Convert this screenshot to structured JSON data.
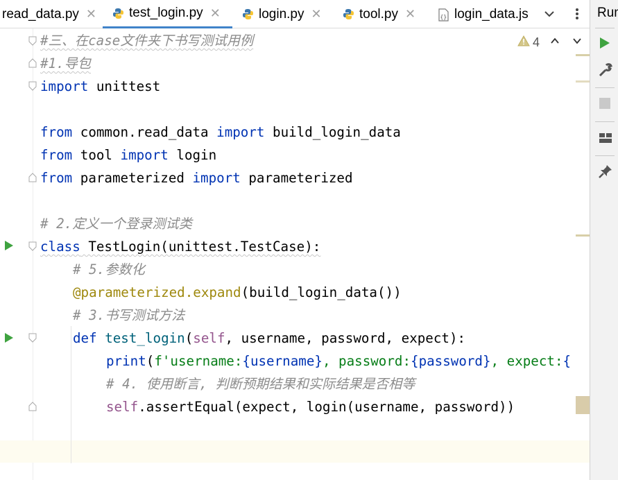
{
  "tabs": [
    {
      "label": "read_data.py",
      "active": false,
      "closable": true
    },
    {
      "label": "test_login.py",
      "active": true,
      "closable": true
    },
    {
      "label": "login.py",
      "active": false,
      "closable": true
    },
    {
      "label": "tool.py",
      "active": false,
      "closable": true
    },
    {
      "label": "login_data.js",
      "active": false,
      "closable": false
    }
  ],
  "right_panel": {
    "title": "Run"
  },
  "inspection": {
    "warning_count": "4"
  },
  "code": {
    "l1": "#三、在case文件夹下书写测试用例",
    "l2": "#1.导包",
    "l3_kw": "import",
    "l3_rest": " unittest",
    "l5_from": "from",
    "l5_mod": " common.read_data ",
    "l5_imp": "import",
    "l5_rest": " build_login_data",
    "l6_from": "from",
    "l6_mod": " tool ",
    "l6_imp": "import",
    "l6_rest": " login",
    "l7_from": "from",
    "l7_mod": " parameterized ",
    "l7_imp": "import",
    "l7_rest": " parameterized",
    "l9": "# 2.定义一个登录测试类",
    "l10_kw": "class",
    "l10_rest": " TestLogin(unittest.TestCase):",
    "l11": "# 5.参数化",
    "l12_deco": "@parameterized.expand",
    "l12_rest": "(build_login_data())",
    "l13": "# 3.书写测试方法",
    "l14_kw": "def",
    "l14_fn": " test_login",
    "l14_p": "(",
    "l14_self": "self",
    "l14_rest": ", username, password, expect):",
    "l15_print": "print",
    "l15_p": "(",
    "l15_s1": "f'username:",
    "l15_b1": "{username}",
    "l15_s2": ", password:",
    "l15_b2": "{password}",
    "l15_s3": ", expect:",
    "l15_b3": "{",
    "l16": "# 4. 使用断言, 判断预期结果和实际结果是否相等",
    "l17_self": "self",
    "l17_rest": ".assertEqual(expect, login(username, password))"
  },
  "colors": {
    "keyword": "#0033b3",
    "comment": "#8c8c8c",
    "decorator": "#9e880d",
    "self": "#94558d",
    "string": "#067d17",
    "function": "#00627a",
    "run": "#3fa340"
  },
  "icons": [
    "python-file-icon",
    "json-file-icon",
    "close-icon",
    "chevron-down-icon",
    "more-icon",
    "warning-icon",
    "chevron-up-icon",
    "run-icon",
    "wrench-icon",
    "stop-icon",
    "layout-icon",
    "pin-icon",
    "fold-icon"
  ]
}
